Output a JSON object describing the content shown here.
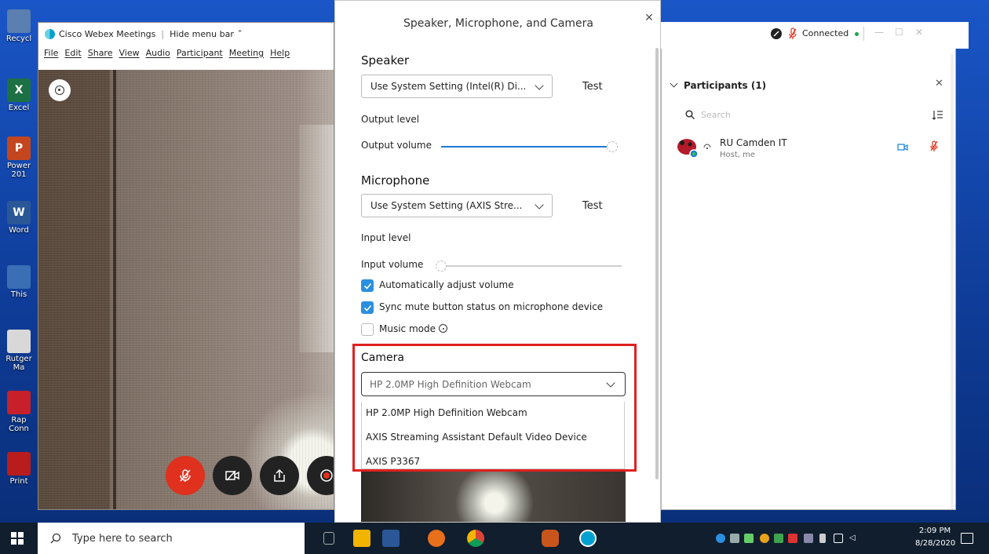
{
  "desktop": {
    "icons": [
      {
        "label": "Recycl",
        "color": "#5a7fb0",
        "glyph": ""
      },
      {
        "label": "Excel",
        "color": "#1d7044",
        "glyph": "X"
      },
      {
        "label": "Power\n201",
        "color": "#c4461f",
        "glyph": "P"
      },
      {
        "label": "Word",
        "color": "#2b5797",
        "glyph": "W"
      },
      {
        "label": "This",
        "color": "#3a6fb5",
        "glyph": ""
      },
      {
        "label": "Rutger\nMa",
        "color": "#d8d8d8",
        "glyph": ""
      },
      {
        "label": "Rap\nConn",
        "color": "#c8202a",
        "glyph": ""
      },
      {
        "label": "Print",
        "color": "#b81c1c",
        "glyph": ""
      }
    ]
  },
  "webex": {
    "app_name": "Cisco Webex Meetings",
    "hide_menu": "Hide menu bar",
    "menu": [
      "File",
      "Edit",
      "Share",
      "View",
      "Audio",
      "Participant",
      "Meeting",
      "Help"
    ]
  },
  "settings": {
    "title": "Speaker, Microphone, and Camera",
    "speaker": {
      "heading": "Speaker",
      "selected": "Use System Setting (Intel(R) Di...",
      "test": "Test",
      "output_level": "Output level",
      "output_volume": "Output volume",
      "volume": 1.0
    },
    "microphone": {
      "heading": "Microphone",
      "selected": "Use System Setting (AXIS Stre...",
      "test": "Test",
      "input_level": "Input level",
      "input_volume": "Input volume",
      "volume": 0.0,
      "auto_adjust": "Automatically adjust volume",
      "sync_mute": "Sync mute button status on microphone device",
      "music_mode": "Music mode"
    },
    "camera": {
      "heading": "Camera",
      "selected": "HP 2.0MP High Definition Webcam",
      "options": [
        "HP 2.0MP High Definition Webcam",
        "AXIS Streaming Assistant Default Video Device",
        "AXIS P3367"
      ]
    }
  },
  "status": {
    "connected": "Connected"
  },
  "participants": {
    "title": "Participants (1)",
    "search_placeholder": "Search",
    "list": [
      {
        "name": "RU Camden IT",
        "role": "Host, me"
      }
    ]
  },
  "taskbar": {
    "search_placeholder": "Type here to search",
    "time": "2:09 PM",
    "date": "8/28/2020"
  },
  "colors": {
    "accent": "#2b8fe0",
    "mute": "#e0301e",
    "highlight": "#e02020",
    "connected": "#1aa54b"
  }
}
